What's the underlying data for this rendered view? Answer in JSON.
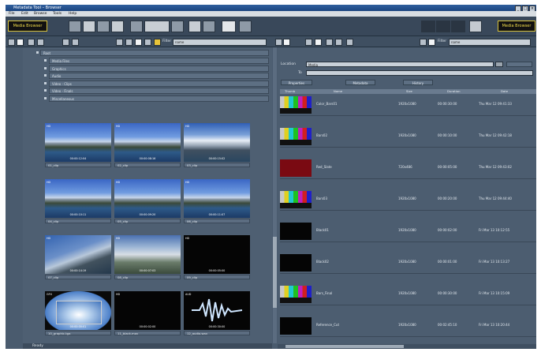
{
  "window": {
    "title": "Metadata Tool – Browser"
  },
  "menu": [
    "File",
    "Edit",
    "Browse",
    "Tools",
    "Help"
  ],
  "toolbar": {
    "left_label": "Media Browser",
    "right_label": "Media Browser"
  },
  "left_filter": {
    "label": "Filter",
    "value": "name"
  },
  "right_filter": {
    "label": "Filter",
    "value": "name"
  },
  "tree": {
    "root": "Root",
    "items": [
      "Media Files",
      "Graphics",
      "Audio",
      "Video - Clips",
      "Video - Finals",
      "Miscellaneous"
    ]
  },
  "thumbnails": [
    {
      "caption": "01_clip",
      "tc": "00:00:12:04",
      "tag": "HD",
      "kind": "mountain"
    },
    {
      "caption": "02_clip",
      "tc": "00:00:08:16",
      "tag": "HD",
      "kind": "mountain"
    },
    {
      "caption": "03_clip",
      "tc": "00:00:15:02",
      "tag": "HD",
      "kind": "snow"
    },
    {
      "caption": "04_clip",
      "tc": "00:00:10:11",
      "tag": "HD",
      "kind": "mountain"
    },
    {
      "caption": "05_clip",
      "tc": "00:00:09:20",
      "tag": "HD",
      "kind": "mountain"
    },
    {
      "caption": "06_clip",
      "tc": "00:00:11:07",
      "tag": "HD",
      "kind": "mountain"
    },
    {
      "caption": "07_clip",
      "tc": "00:00:14:19",
      "tag": "HD",
      "kind": "water"
    },
    {
      "caption": "08_clip",
      "tc": "00:00:07:03",
      "tag": "HD",
      "kind": "river"
    },
    {
      "caption": "09_clip",
      "tc": "00:00:05:00",
      "tag": "HD",
      "kind": "black"
    },
    {
      "caption": "10_graphic.tga",
      "tc": "00:00:00:01",
      "tag": "GFX",
      "kind": "sky"
    },
    {
      "caption": "11_black.mov",
      "tc": "00:00:02:00",
      "tag": "HD",
      "kind": "black"
    },
    {
      "caption": "12_audio.wav",
      "tc": "00:00:30:00",
      "tag": "AUD",
      "kind": "audio"
    }
  ],
  "details": {
    "location_label": "Location",
    "location_value": "Media",
    "to_label": "To",
    "to_value": "",
    "tabs": [
      "Properties",
      "Metadata",
      "History"
    ]
  },
  "table": {
    "columns": [
      "Thumb",
      "Name",
      "Size",
      "Duration",
      "Date"
    ],
    "rows": [
      {
        "name": "Color_Bars01",
        "size": "1920x1080",
        "dur": "00:00:30:00",
        "date": "Thu Mar 12 09:41:33",
        "kind": "bars"
      },
      {
        "name": "Bars02",
        "size": "1920x1080",
        "dur": "00:00:10:00",
        "date": "Thu Mar 12 09:42:18",
        "kind": "bars"
      },
      {
        "name": "Red_Slate",
        "size": "720x486",
        "dur": "00:00:05:00",
        "date": "Thu Mar 12 09:43:02",
        "kind": "red"
      },
      {
        "name": "Bars03",
        "size": "1920x1080",
        "dur": "00:00:20:00",
        "date": "Thu Mar 12 09:44:40",
        "kind": "bars"
      },
      {
        "name": "Black01",
        "size": "1920x1080",
        "dur": "00:00:02:00",
        "date": "Fri Mar 13 10:12:55",
        "kind": "black"
      },
      {
        "name": "Black02",
        "size": "1920x1080",
        "dur": "00:00:01:00",
        "date": "Fri Mar 13 10:13:27",
        "kind": "black"
      },
      {
        "name": "Bars_Final",
        "size": "1920x1080",
        "dur": "00:00:30:00",
        "date": "Fri Mar 13 10:15:09",
        "kind": "bars"
      },
      {
        "name": "Reference_Cut",
        "size": "1920x1080",
        "dur": "00:02:45:10",
        "date": "Fri Mar 13 10:20:44",
        "kind": "black"
      }
    ]
  },
  "status": {
    "text": "Ready"
  }
}
